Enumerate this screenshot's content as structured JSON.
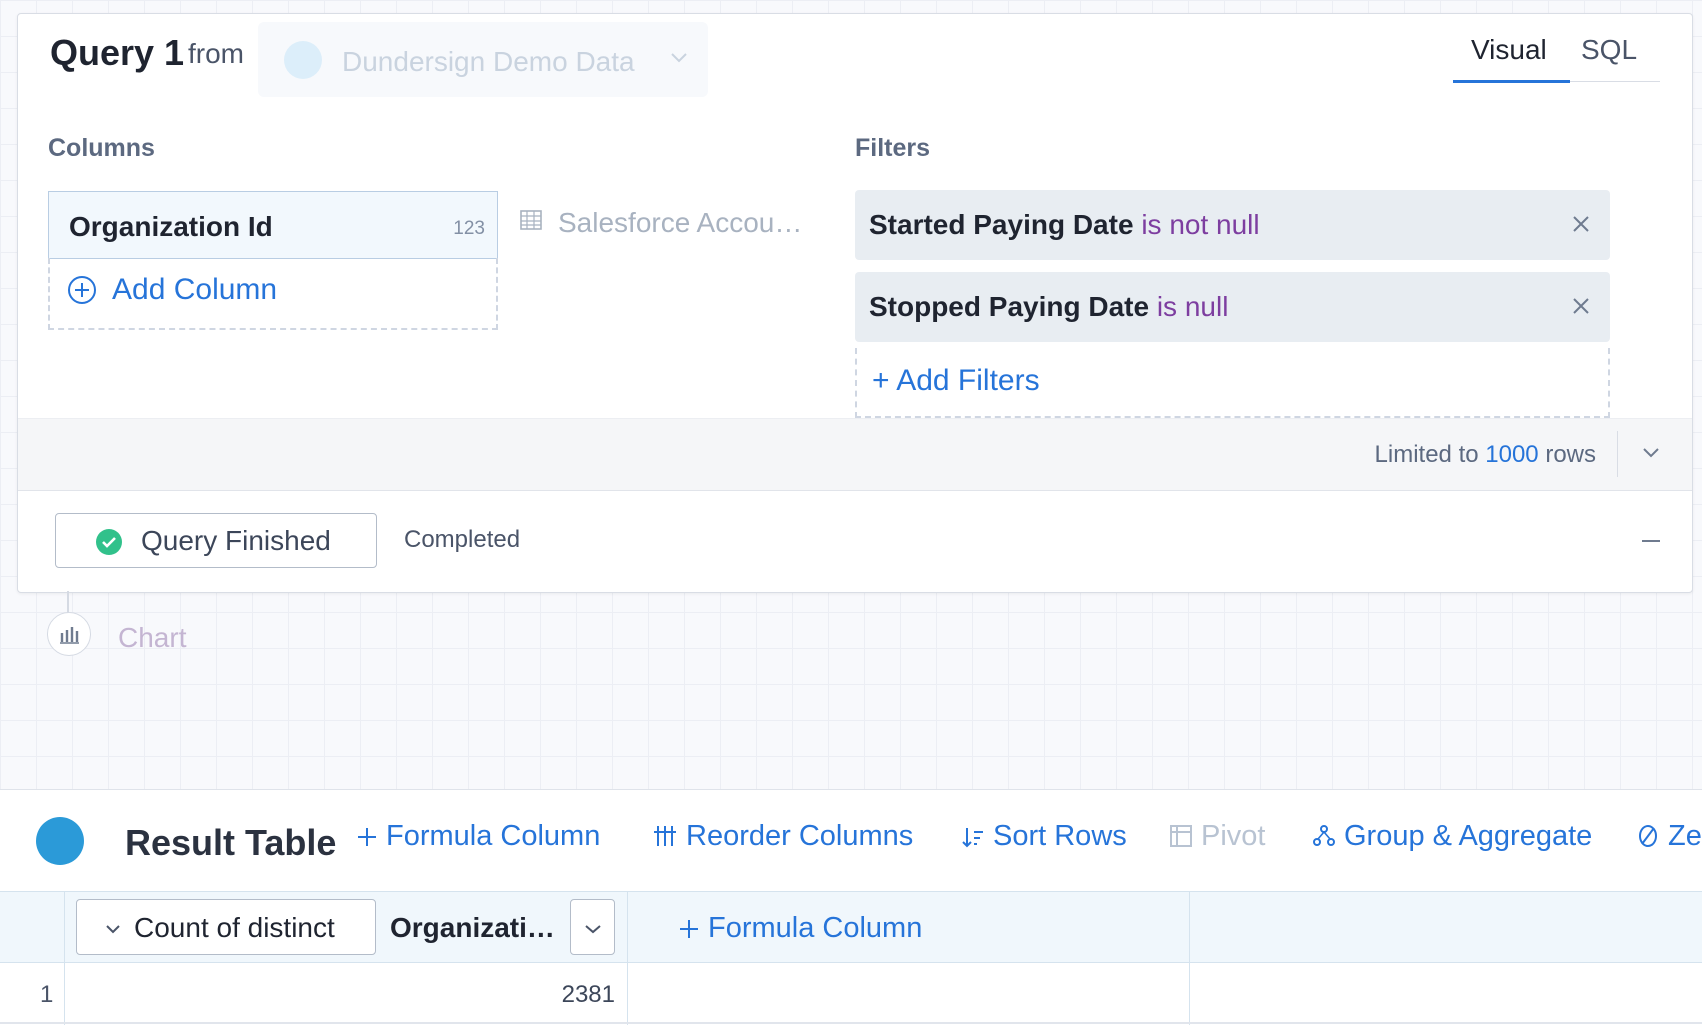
{
  "query": {
    "title": "Query 1",
    "from_label": "from",
    "source": "Dundersign Demo Data",
    "tabs": [
      "Visual",
      "SQL"
    ],
    "active_tab": "Visual",
    "columns_label": "Columns",
    "filters_label": "Filters",
    "column": {
      "name": "Organization Id",
      "type": "123"
    },
    "add_column": "Add Column",
    "table_ref": "Salesforce Accou…",
    "filters": [
      {
        "field": "Started Paying Date",
        "op": "is not null"
      },
      {
        "field": "Stopped Paying Date",
        "op": "is null"
      }
    ],
    "add_filters": "+ Add Filters",
    "limit_prefix": "Limited to",
    "limit_num": "1000",
    "limit_suffix": "rows",
    "status_button": "Query Finished",
    "status_text": "Completed"
  },
  "chart_step": {
    "label": "Chart"
  },
  "result": {
    "title": "Result Table",
    "tools": [
      "Formula Column",
      "Reorder Columns",
      "Sort Rows",
      "Pivot",
      "Group & Aggregate",
      "Ze"
    ],
    "aggregate": "Count of distinct",
    "column_name": "Organizati…",
    "add_formula": "Formula Column",
    "rows": [
      {
        "num": "1",
        "value": "2381"
      }
    ]
  },
  "colors": {
    "accent": "#2674d9",
    "operator": "#7d3ea0",
    "success": "#31c18b"
  }
}
